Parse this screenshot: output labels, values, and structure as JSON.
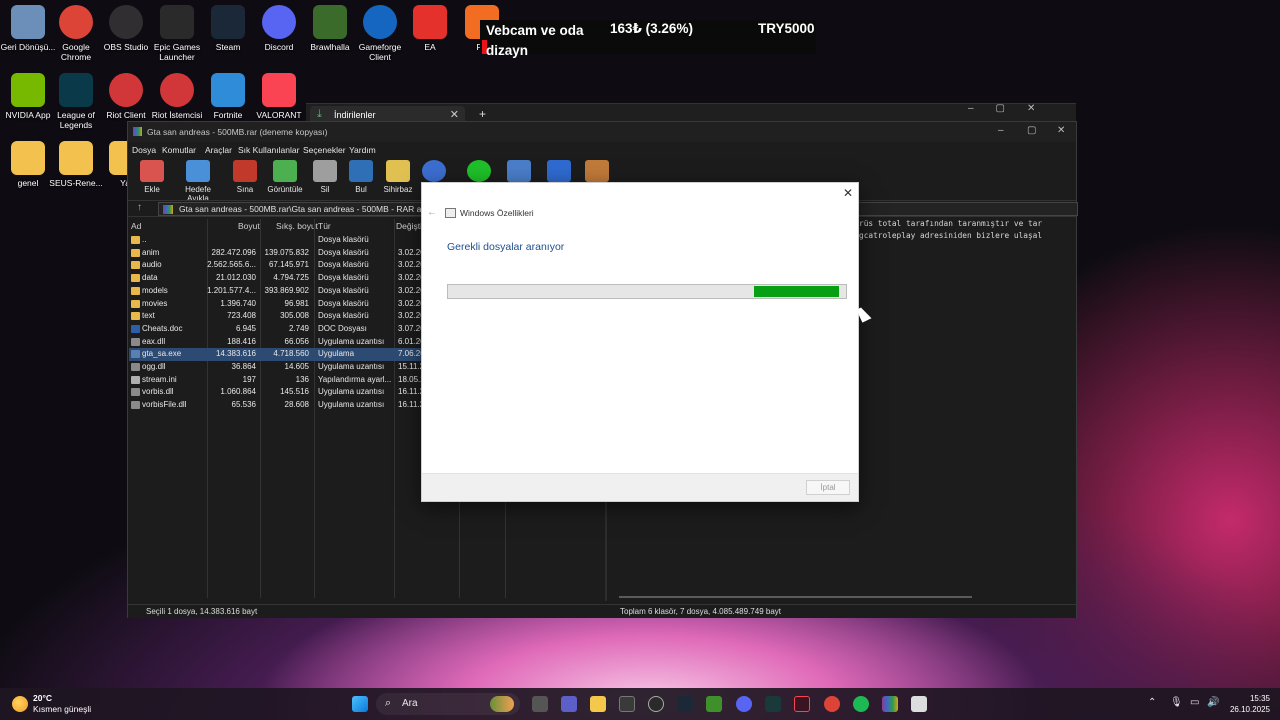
{
  "desktop_icons": [
    {
      "label": "Geri Dönüşü...",
      "icon": "recycle-bin-icon",
      "color": "#6b8fb8"
    },
    {
      "label": "Google Chrome",
      "icon": "chrome-icon",
      "color": "#db4437"
    },
    {
      "label": "OBS Studio",
      "icon": "obs-icon",
      "color": "#302e31"
    },
    {
      "label": "Epic Games Launcher",
      "icon": "epic-games-icon",
      "color": "#2a2a2a"
    },
    {
      "label": "Steam",
      "icon": "steam-icon",
      "color": "#1b2838"
    },
    {
      "label": "Discord",
      "icon": "discord-icon",
      "color": "#5865f2"
    },
    {
      "label": "Brawlhalla",
      "icon": "brawlhalla-icon",
      "color": "#3a6b2a"
    },
    {
      "label": "Gameforge Client",
      "icon": "gameforge-icon",
      "color": "#1566c0"
    },
    {
      "label": "EA",
      "icon": "ea-icon",
      "color": "#e4312b"
    },
    {
      "label": "Fiv",
      "icon": "fivem-icon",
      "color": "#f26d21"
    },
    {
      "label": "NVIDIA App",
      "icon": "nvidia-icon",
      "color": "#76b900"
    },
    {
      "label": "League of Legends",
      "icon": "league-icon",
      "color": "#0a3a4a"
    },
    {
      "label": "Riot Client",
      "icon": "riot-client-icon",
      "color": "#d13639"
    },
    {
      "label": "Riot İstemcisi",
      "icon": "riot-client-icon",
      "color": "#d13639"
    },
    {
      "label": "Fortnite",
      "icon": "fortnite-icon",
      "color": "#2f8cd8"
    },
    {
      "label": "VALORANT",
      "icon": "valorant-icon",
      "color": "#fa4454"
    },
    {
      "label": "genel",
      "icon": "folder-icon",
      "color": "#f2c14e"
    },
    {
      "label": "SEUS-Rene...",
      "icon": "folder-icon",
      "color": "#f2c14e"
    },
    {
      "label": "Yal",
      "icon": "folder-icon",
      "color": "#f2c14e"
    }
  ],
  "overlay": {
    "label": "Vebcam ve oda dizayn",
    "price": "163₺ (3.26%)",
    "symbol": "TRY5000",
    "accent": "#e8141b"
  },
  "explorer": {
    "tab_label": "İndirilenler"
  },
  "winrar": {
    "title": "Gta san andreas - 500MB.rar (deneme kopyası)",
    "menu": [
      "Dosya",
      "Komutlar",
      "Araçlar",
      "Sık Kullanılanlar",
      "Seçenekler",
      "Yardım"
    ],
    "toolbar": [
      "Ekle",
      "Hedefe Ayıkla",
      "Sına",
      "Görüntüle",
      "Sil",
      "Bul",
      "Sihirbaz",
      "",
      "",
      "",
      "",
      ""
    ],
    "path": "Gta san andreas - 500MB.rar\\Gta san andreas - 500MB - RAR arşivi, açı",
    "columns": [
      "Ad",
      "Boyut",
      "Sıkş. boyut",
      "Tür",
      "Değiştir"
    ],
    "rows": [
      {
        "name": "..",
        "size": "",
        "packed": "",
        "type": "Dosya klasörü",
        "modified": "",
        "kind": "folder"
      },
      {
        "name": "anim",
        "size": "282.472.096",
        "packed": "139.075.832",
        "type": "Dosya klasörü",
        "modified": "3.02.20",
        "kind": "folder"
      },
      {
        "name": "audio",
        "size": "2.562.565.6...",
        "packed": "67.145.971",
        "type": "Dosya klasörü",
        "modified": "3.02.20",
        "kind": "folder"
      },
      {
        "name": "data",
        "size": "21.012.030",
        "packed": "4.794.725",
        "type": "Dosya klasörü",
        "modified": "3.02.20",
        "kind": "folder"
      },
      {
        "name": "models",
        "size": "1.201.577.4...",
        "packed": "393.869.902",
        "type": "Dosya klasörü",
        "modified": "3.02.20",
        "kind": "folder"
      },
      {
        "name": "movies",
        "size": "1.396.740",
        "packed": "96.981",
        "type": "Dosya klasörü",
        "modified": "3.02.20",
        "kind": "folder"
      },
      {
        "name": "text",
        "size": "723.408",
        "packed": "305.008",
        "type": "Dosya klasörü",
        "modified": "3.02.20",
        "kind": "folder"
      },
      {
        "name": "Cheats.doc",
        "size": "6.945",
        "packed": "2.749",
        "type": "DOC Dosyası",
        "modified": "3.07.20",
        "kind": "doc"
      },
      {
        "name": "eax.dll",
        "size": "188.416",
        "packed": "66.056",
        "type": "Uygulama uzantısı",
        "modified": "6.01.20",
        "kind": "dll"
      },
      {
        "name": "gta_sa.exe",
        "size": "14.383.616",
        "packed": "4.718.560",
        "type": "Uygulama",
        "modified": "7.06.20",
        "kind": "exe",
        "selected": true
      },
      {
        "name": "ogg.dll",
        "size": "36.864",
        "packed": "14.605",
        "type": "Uygulama uzantısı",
        "modified": "15.11.2",
        "kind": "dll"
      },
      {
        "name": "stream.ini",
        "size": "197",
        "packed": "136",
        "type": "Yapılandırma ayarl...",
        "modified": "18.05.2",
        "kind": "ini"
      },
      {
        "name": "vorbis.dll",
        "size": "1.060.864",
        "packed": "145.516",
        "type": "Uygulama uzantısı",
        "modified": "16.11.2",
        "kind": "dll"
      },
      {
        "name": "vorbisFile.dll",
        "size": "65.536",
        "packed": "28.608",
        "type": "Uygulama uzantısı",
        "modified": "16.11.2",
        "kind": "dll"
      }
    ],
    "comment_lines": [
      "rüs total tarafından taranmıştır ve tar",
      "gcatroleplay adresiniden bizlere ulaşal"
    ],
    "status_left": "Seçili 1 dosya, 14.383.616 bayt",
    "status_right": "Toplam 6 klasör, 7 dosya, 4.085.489.749 bayt"
  },
  "dialog": {
    "title": "Windows Özellikleri",
    "heading": "Gerekli dosyalar aranıyor",
    "cancel": "İptal",
    "progress_color": "#06a012"
  },
  "taskbar": {
    "temperature": "20°C",
    "weather": "Kısmen güneşli",
    "search_placeholder": "Ara",
    "time": "15:35",
    "date": "26.10.2025"
  }
}
